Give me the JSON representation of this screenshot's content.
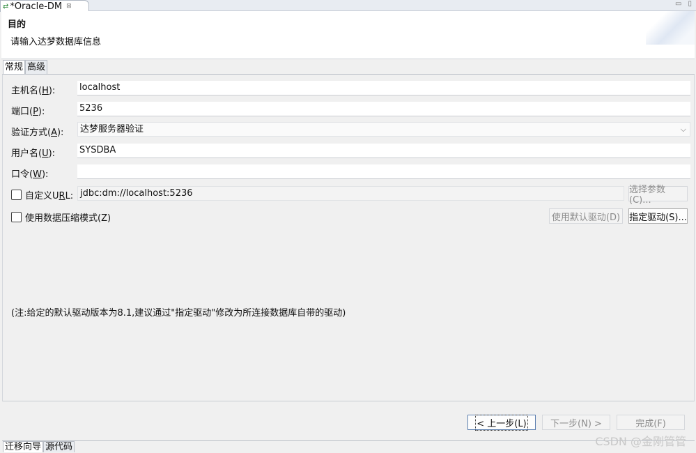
{
  "editor_tab": {
    "title": "*Oracle-DM",
    "close_glyph": "⊠",
    "icon": "sync-arrows-icon"
  },
  "window_controls": {
    "minimize": "▭",
    "maximize": "▯"
  },
  "banner": {
    "title": "目的",
    "description": "请输入达梦数据库信息"
  },
  "tabs": [
    {
      "label": "常规",
      "active": true
    },
    {
      "label": "高级",
      "active": false
    }
  ],
  "form": {
    "host_label_pre": "主机名(",
    "host_label_key": "H",
    "host_label_post": "):",
    "host_value": "localhost",
    "port_label_pre": "端口(",
    "port_label_key": "P",
    "port_label_post": "):",
    "port_value": "5236",
    "auth_label_pre": "验证方式(",
    "auth_label_key": "A",
    "auth_label_post": "):",
    "auth_value": "达梦服务器验证",
    "user_label_pre": "用户名(",
    "user_label_key": "U",
    "user_label_post": "):",
    "user_value": "SYSDBA",
    "pwd_label_pre": "口令(",
    "pwd_label_key": "W",
    "pwd_label_post": "):",
    "pwd_value": "",
    "custom_url_label_pre": "自定义U",
    "custom_url_label_key": "R",
    "custom_url_label_post": "L:",
    "custom_url_value": "jdbc:dm://localhost:5236",
    "select_params_button": "选择参数(C)...",
    "compress_label": "使用数据压缩模式(Z)",
    "default_driver_button": "使用默认驱动(D)",
    "specify_driver_button": "指定驱动(S)...",
    "note": "(注:给定的默认驱动版本为8.1,建议通过\"指定驱动\"修改为所连接数据库自带的驱动)"
  },
  "footer": {
    "back_button": "< 上一步(L)",
    "next_button": "下一步(N) >",
    "finish_button": "完成(F)"
  },
  "bottom_tabs": [
    {
      "label": "迁移向导"
    },
    {
      "label": "源代码"
    }
  ],
  "watermark": "CSDN @金刚管管",
  "colors": {
    "accent_border": "#5c7fb0",
    "panel_bg": "#f0f0f0"
  }
}
